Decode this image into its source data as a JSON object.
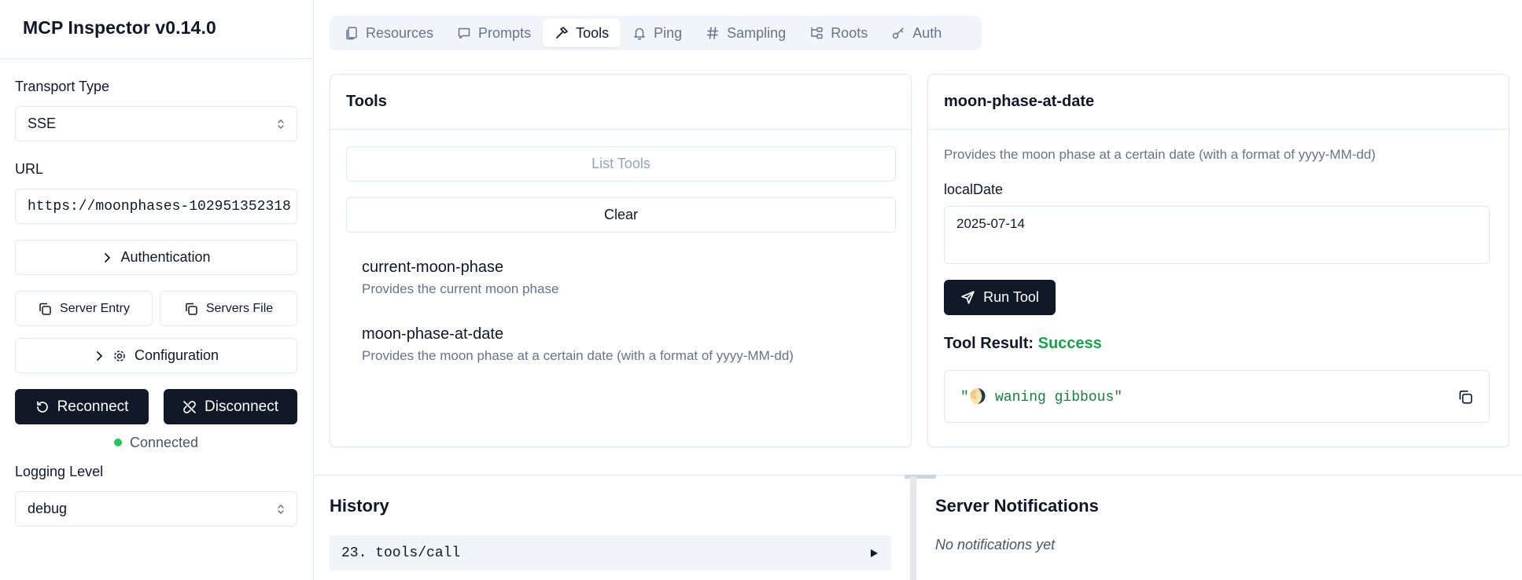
{
  "app": {
    "title": "MCP Inspector v0.14.0"
  },
  "sidebar": {
    "transport_label": "Transport Type",
    "transport_value": "SSE",
    "url_label": "URL",
    "url_value": "https://moonphases-102951352318",
    "authentication_label": "Authentication",
    "server_entry_label": "Server Entry",
    "servers_file_label": "Servers File",
    "configuration_label": "Configuration",
    "reconnect_label": "Reconnect",
    "disconnect_label": "Disconnect",
    "status_text": "Connected",
    "status_color": "#22c55e",
    "logging_label": "Logging Level",
    "logging_value": "debug"
  },
  "tabs": [
    {
      "label": "Resources",
      "icon": "files-icon",
      "active": false
    },
    {
      "label": "Prompts",
      "icon": "message-icon",
      "active": false
    },
    {
      "label": "Tools",
      "icon": "hammer-icon",
      "active": true
    },
    {
      "label": "Ping",
      "icon": "bell-icon",
      "active": false
    },
    {
      "label": "Sampling",
      "icon": "hash-icon",
      "active": false
    },
    {
      "label": "Roots",
      "icon": "folder-tree-icon",
      "active": false
    },
    {
      "label": "Auth",
      "icon": "key-icon",
      "active": false
    }
  ],
  "tools_panel": {
    "title": "Tools",
    "list_button": "List Tools",
    "clear_button": "Clear",
    "items": [
      {
        "name": "current-moon-phase",
        "description": "Provides the current moon phase"
      },
      {
        "name": "moon-phase-at-date",
        "description": "Provides the moon phase at a certain date (with a format of yyyy-MM-dd)"
      }
    ]
  },
  "tool_detail": {
    "title": "moon-phase-at-date",
    "description": "Provides the moon phase at a certain date (with a format of yyyy-MM-dd)",
    "param_label": "localDate",
    "param_value": "2025-07-14",
    "run_button": "Run Tool",
    "result_label": "Tool Result:",
    "result_status": "Success",
    "result_text": "\"🌖 waning gibbous\""
  },
  "history": {
    "title": "History",
    "entries": [
      {
        "label": "23. tools/call"
      }
    ]
  },
  "notifications": {
    "title": "Server Notifications",
    "empty_text": "No notifications yet"
  },
  "colors": {
    "accent_dark": "#111827",
    "success": "#16a34a",
    "muted": "#64748b",
    "border": "#e2e8f0"
  }
}
